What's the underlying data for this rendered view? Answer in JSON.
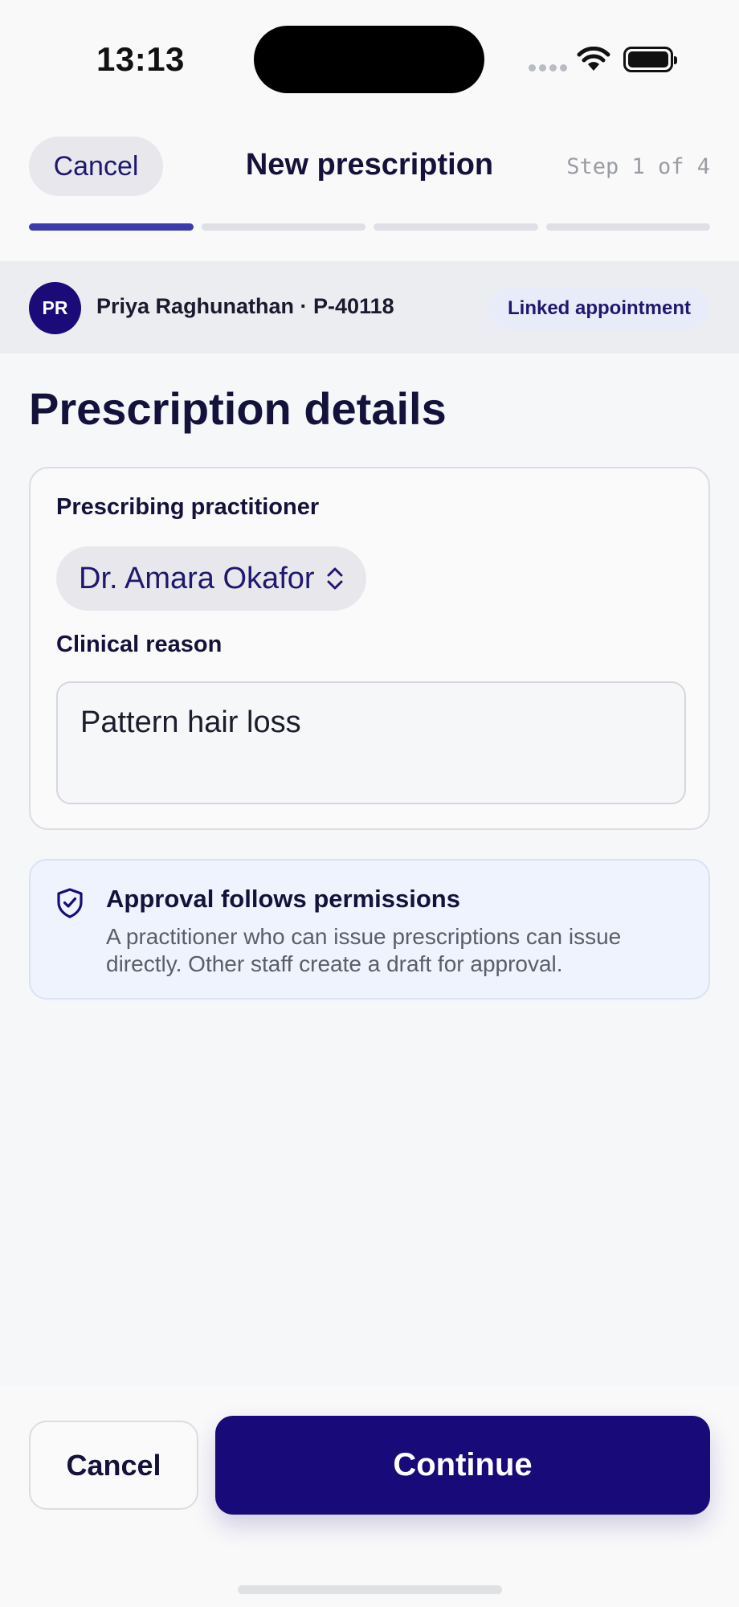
{
  "status_bar": {
    "time": "13:13"
  },
  "header": {
    "cancel_label": "Cancel",
    "title": "New prescription",
    "step_text": "Step 1 of 4",
    "progress_current_step": 1,
    "progress_total_steps": 4,
    "accent_color": "#3b3cab"
  },
  "patient": {
    "initials": "PR",
    "name_and_id": "Priya Raghunathan · P-40118",
    "badge": "Linked appointment"
  },
  "section_title": "Prescription details",
  "form": {
    "practitioner_label": "Prescribing practitioner",
    "practitioner_value": "Dr. Amara Okafor",
    "practitioner_icon": "chevron-up-down-icon",
    "reason_label": "Clinical reason",
    "reason_value": "Pattern hair loss"
  },
  "callout": {
    "icon": "shield-check-icon",
    "title": "Approval follows permissions",
    "body": "A practitioner who can issue prescriptions can issue directly. Other staff create a draft for approval."
  },
  "footer": {
    "cancel_label": "Cancel",
    "continue_label": "Continue",
    "primary_color": "#180a78"
  }
}
